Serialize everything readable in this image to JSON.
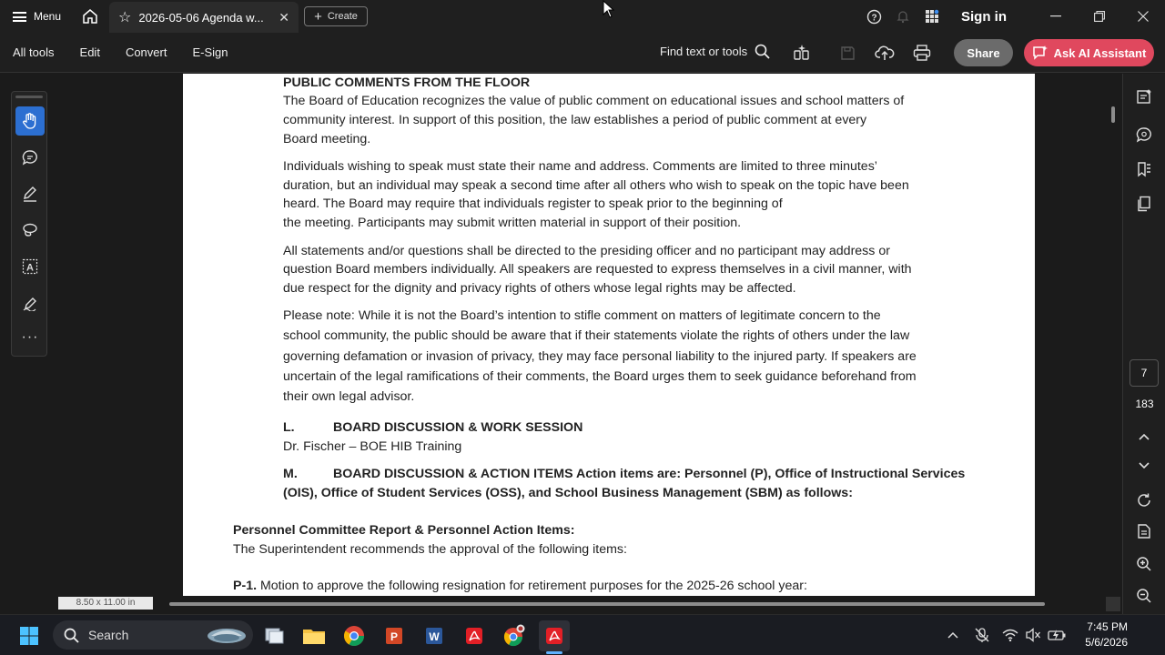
{
  "titlebar": {
    "menu_label": "Menu",
    "tab_title": "2026-05-06 Agenda w...",
    "create_label": "Create",
    "signin_label": "Sign in"
  },
  "toolbar": {
    "items": [
      "All tools",
      "Edit",
      "Convert",
      "E-Sign"
    ],
    "find_label": "Find text or tools",
    "share_label": "Share",
    "ai_label": "Ask AI Assistant"
  },
  "document": {
    "heading_public": "PUBLIC COMMENTS FROM THE FLOOR",
    "p1_l1": "The Board of Education recognizes the value of public comment on educational issues and school matters of",
    "p1_l2": "community interest.  In support of this position, the law establishes a period of public comment at every",
    "p1_l3": "Board meeting.",
    "p2_l1": "Individuals wishing to speak must state their name and address.  Comments are limited to three minutes’",
    "p2_l2": "duration, but an individual may speak a second time after all others who wish to speak on the topic have been",
    "p2_l3": "heard.  The Board may require that individuals register to speak prior to the beginning of",
    "p2_l4": "the meeting.  Participants may submit written material in support of their position.",
    "p3_l1": "All statements and/or questions shall be directed to the presiding officer and no participant may address or",
    "p3_l2": "question Board members individually. All speakers are requested to express themselves in a civil manner, with",
    "p3_l3": "due respect for the dignity and privacy rights of others whose legal rights may be affected.",
    "p4_l1": "Please note:  While it is not the Board’s intention to stifle comment on matters of legitimate concern to the",
    "p4_l2": "school community, the public should be aware that if their statements violate the rights of others under the law",
    "p4_l3": "governing defamation or invasion of privacy, they may face personal liability to the injured party.  If speakers are",
    "p4_l4": "uncertain of the legal ramifications of their comments, the Board urges them to seek guidance beforehand from",
    "p4_l5": "their own legal advisor.",
    "sec_l_letter": "L.",
    "sec_l_title": "BOARD DISCUSSION & WORK SESSION",
    "sec_l_item": "Dr. Fischer – BOE HIB Training",
    "sec_m_letter": "M.",
    "sec_m_l1": "BOARD DISCUSSION & ACTION ITEMS Action items are: Personnel (P), Office of Instructional Services",
    "sec_m_l2": "(OIS), Office of Student Services (OSS), and School Business Management (SBM) as follows:",
    "personnel_heading": "Personnel Committee Report & Personnel Action Items:",
    "personnel_text": "The Superintendent recommends the approval of the following items:",
    "p1_label": "P-1.",
    "p1_text": " Motion to approve the following resignation for retirement purposes for the 2025-26 school year:"
  },
  "status": {
    "page_size": "8.50 x 11.00 in",
    "current_page": "7",
    "total_pages": "183"
  },
  "taskbar": {
    "search_label": "Search",
    "time": "7:45 PM",
    "date": "5/6/2026"
  }
}
